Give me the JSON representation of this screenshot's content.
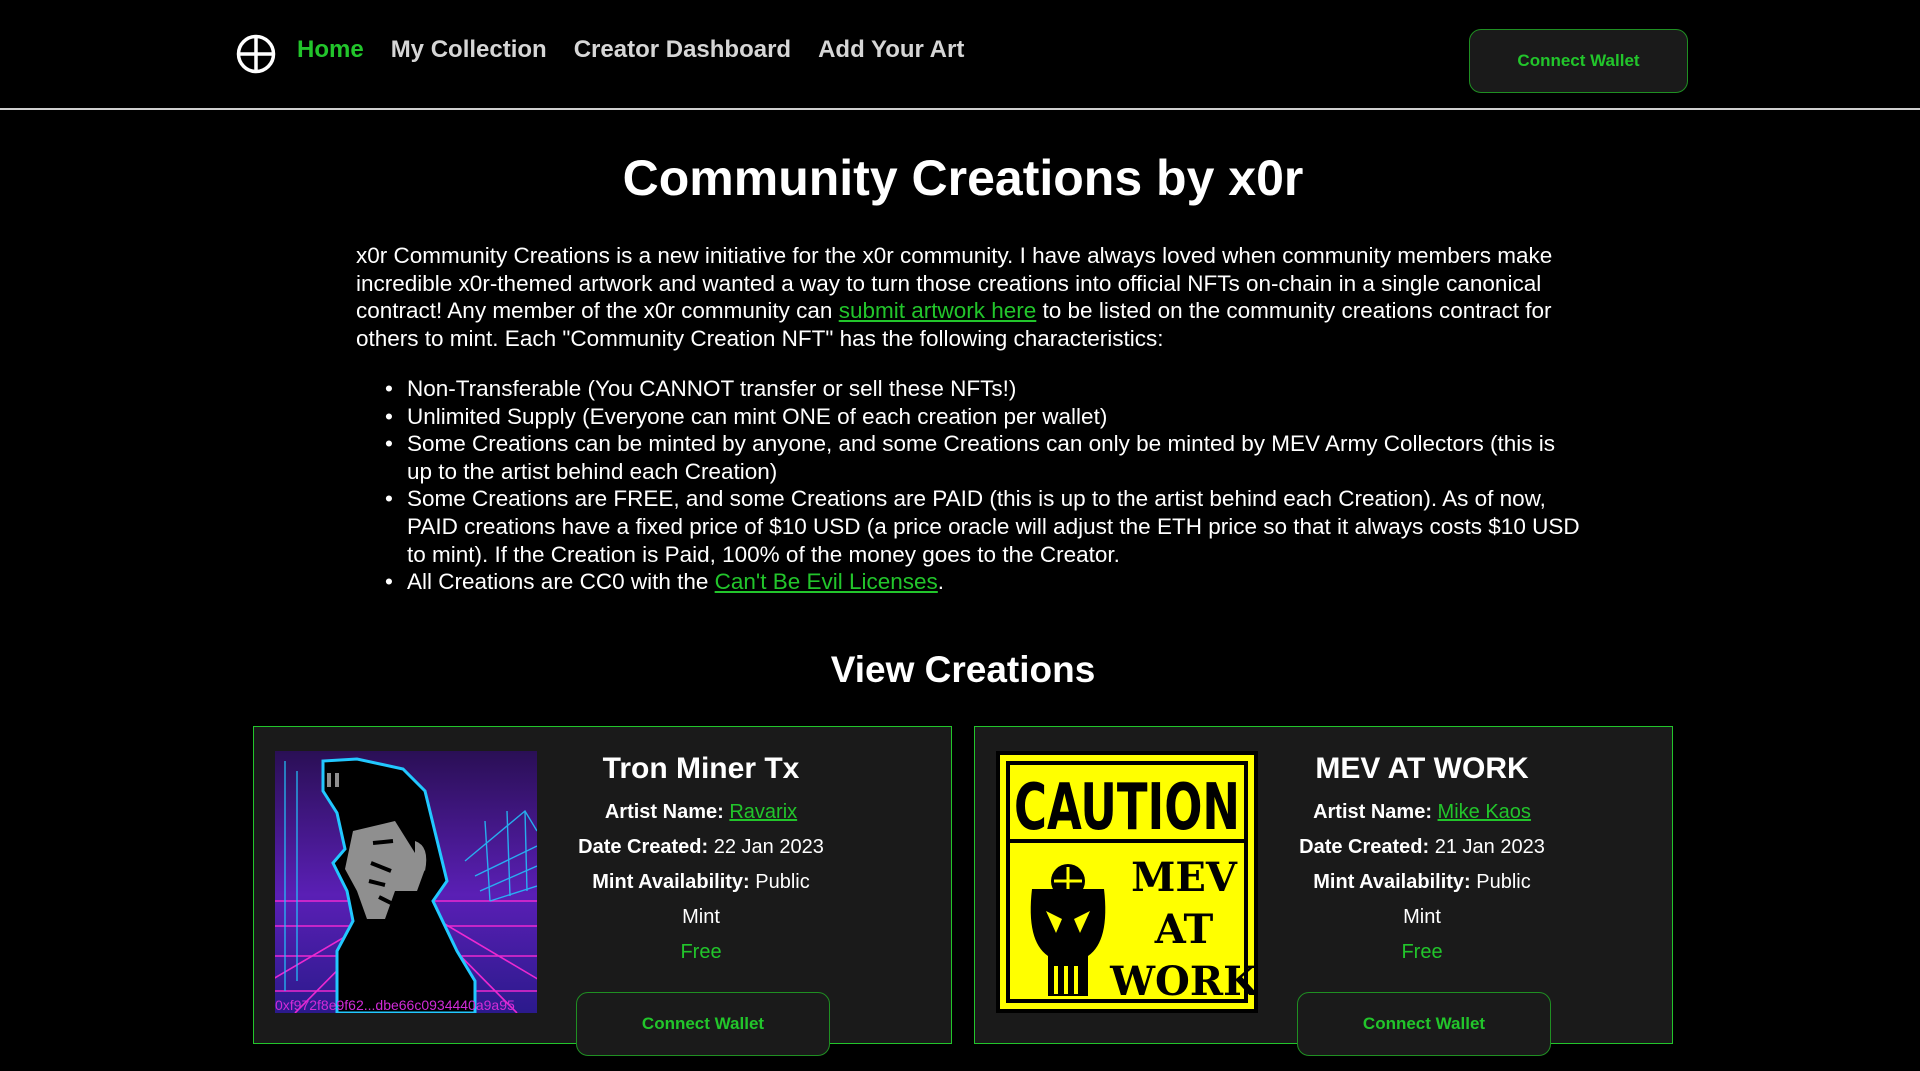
{
  "nav": {
    "items": [
      {
        "label": "Home",
        "active": true
      },
      {
        "label": "My Collection",
        "active": false
      },
      {
        "label": "Creator Dashboard",
        "active": false
      },
      {
        "label": "Add Your Art",
        "active": false
      }
    ],
    "wallet_label": "Connect Wallet"
  },
  "page": {
    "title": "Community Creations by x0r",
    "intro_before": "x0r Community Creations is a new initiative for the x0r community. I have always loved when community members make incredible x0r-themed artwork and wanted a way to turn those creations into official NFTs on-chain in a single canonical contract! Any member of the x0r community can ",
    "intro_link": "submit artwork here",
    "intro_after": " to be listed on the community creations contract for others to mint. Each \"Community Creation NFT\" has the following characteristics:",
    "bullets": [
      "Non-Transferable (You CANNOT transfer or sell these NFTs!)",
      "Unlimited Supply (Everyone can mint ONE of each creation per wallet)",
      "Some Creations can be minted by anyone, and some Creations can only be minted by MEV Army Collectors (this is up to the artist behind each Creation)",
      "Some Creations are FREE, and some Creations are PAID (this is up to the artist behind each Creation). As of now, PAID creations have a fixed price of $10 USD (a price oracle will adjust the ETH price so that it always costs $10 USD to mint). If the Creation is Paid, 100% of the money goes to the Creator."
    ],
    "last_bullet_before": "All Creations are CC0 with the ",
    "last_bullet_link": "Can't Be Evil Licenses",
    "last_bullet_after": ".",
    "section_title": "View Creations"
  },
  "labels": {
    "artist": "Artist Name:",
    "date": "Date Created:",
    "mint": "Mint Availability:"
  },
  "cards": [
    {
      "title": "Tron Miner Tx",
      "artist": "Ravarix",
      "date": "22 Jan 2023",
      "mint": "Public Mint",
      "price": "Free",
      "button": "Connect Wallet",
      "address": "0xf972f8e9f62...dbe66c0934440a9a95"
    },
    {
      "title": "MEV AT WORK",
      "artist": "Mike Kaos",
      "date": "21 Jan 2023",
      "mint": "Public Mint",
      "price": "Free",
      "button": "Connect Wallet",
      "sign_top": "CAUTION",
      "sign_lines": [
        "MEV",
        "AT",
        "WORK"
      ]
    }
  ],
  "colors": {
    "accent": "#22c52b",
    "background": "#000000",
    "card": "#1a1a1a",
    "caution_yellow": "#ffff00",
    "address_magenta": "#d12bd8"
  }
}
